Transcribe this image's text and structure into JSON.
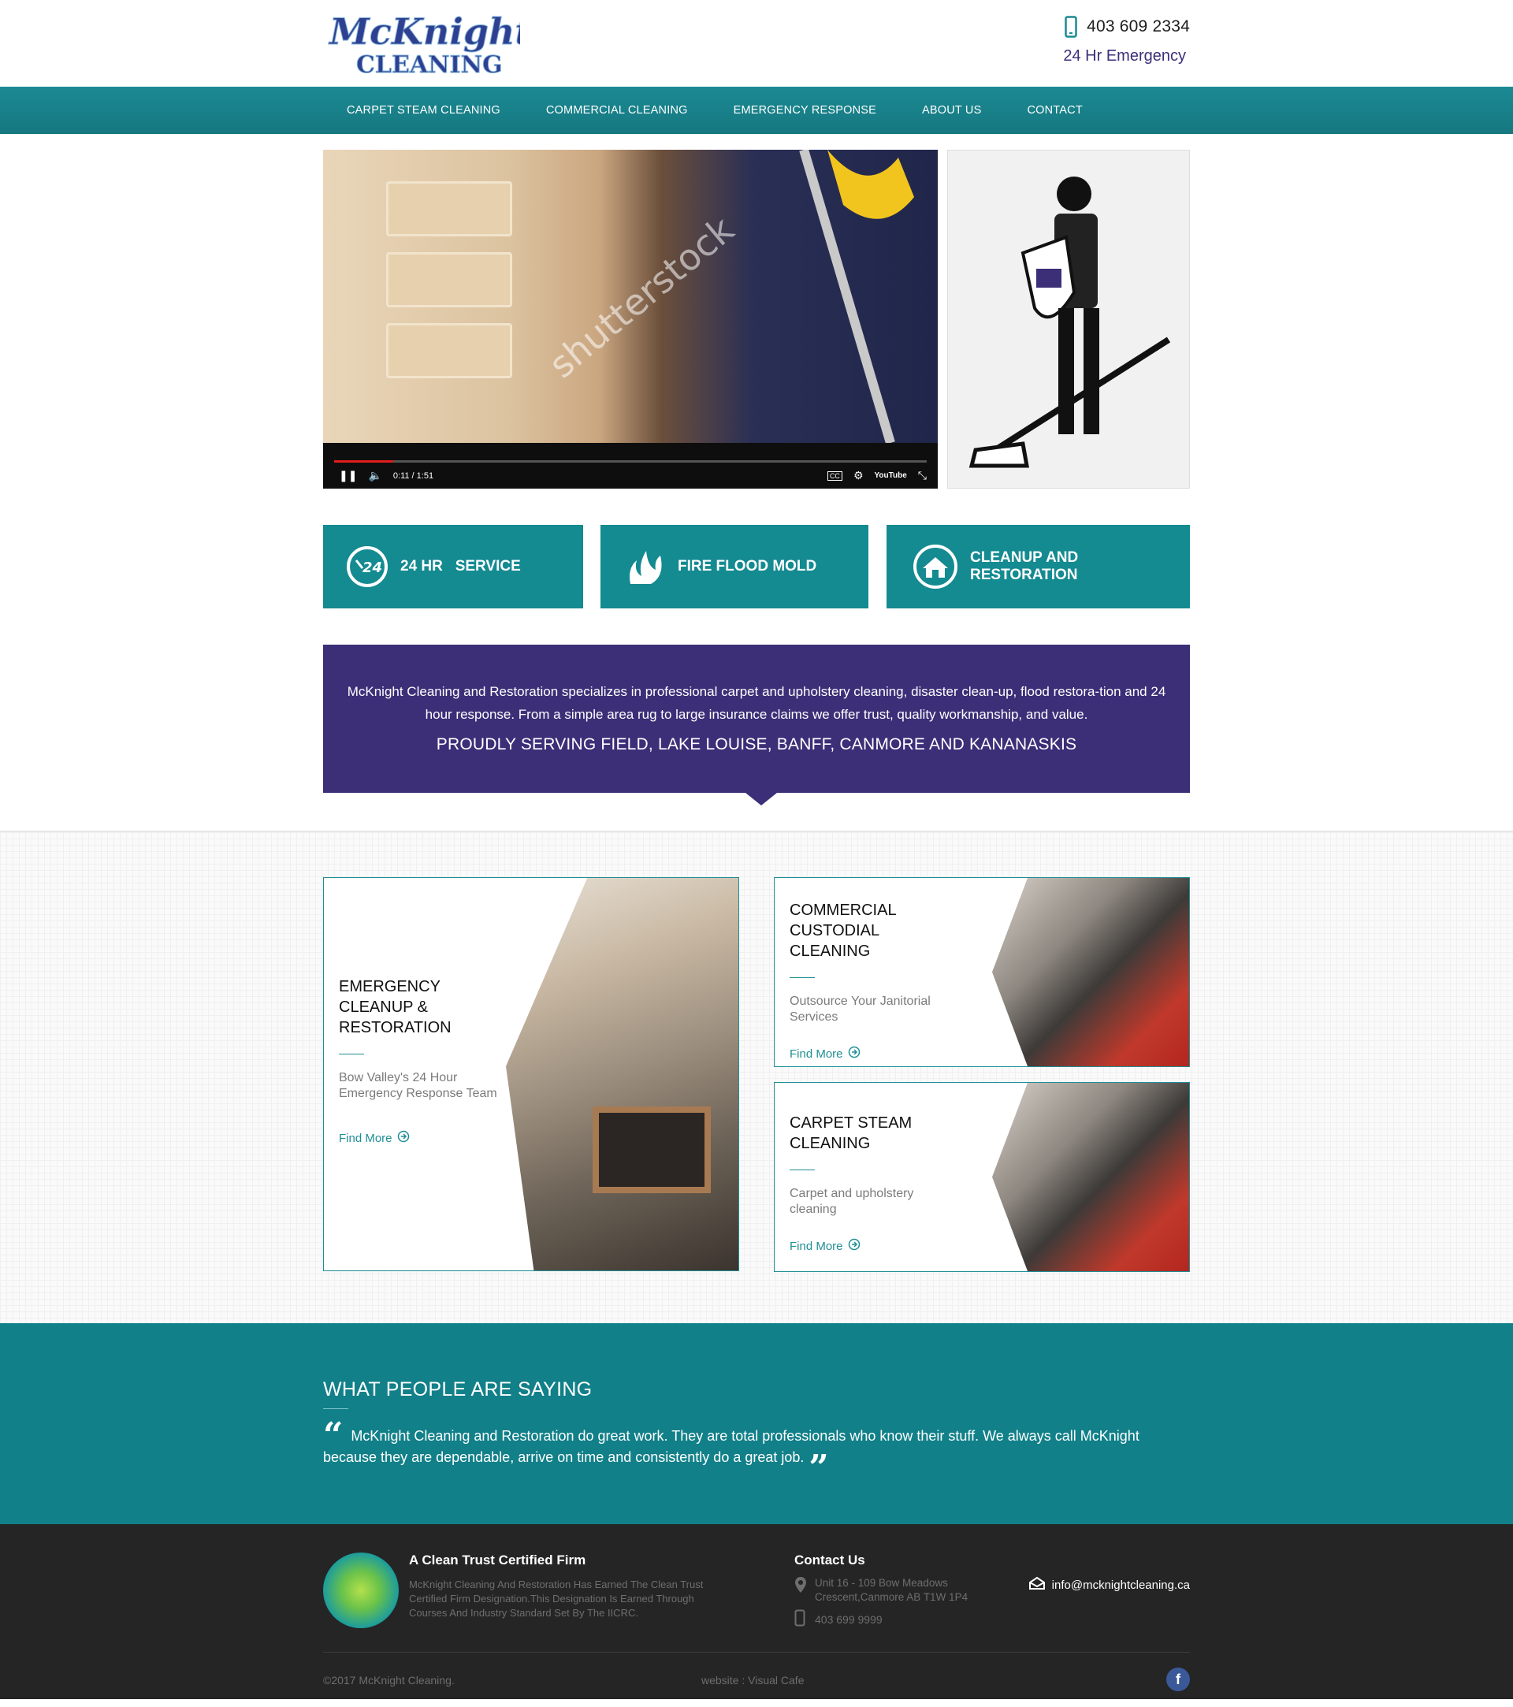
{
  "header": {
    "logo_line1": "McKnight",
    "logo_line2": "CLEANING",
    "phone": "403 609 2334",
    "emergency": "24 Hr Emergency"
  },
  "nav": {
    "items": [
      "CARPET STEAM CLEANING",
      "COMMERCIAL CLEANING",
      "EMERGENCY RESPONSE",
      "ABOUT US",
      "CONTACT"
    ]
  },
  "video": {
    "watermark": "shutterstock",
    "time": "0:11 / 1:51",
    "progress": 0.1,
    "cc_label": "CC",
    "youtube_label": "YouTube"
  },
  "features": [
    {
      "label": "24 HR   SERVICE",
      "icon": "clock-24-icon"
    },
    {
      "label": "FIRE FLOOD MOLD",
      "icon": "flame-water-icon"
    },
    {
      "label": "CLEANUP AND RESTORATION",
      "icon": "home-circle-icon"
    }
  ],
  "banner": {
    "text": "McKnight Cleaning and Restoration specializes in professional carpet and upholstery cleaning, disaster clean-up, flood restora-tion and 24 hour response.  From a simple area rug to large insurance claims we offer trust, quality workmanship, and value.",
    "headline": "PROUDLY SERVING FIELD, LAKE LOUISE, BANFF, CANMORE AND KANANASKIS"
  },
  "cards": [
    {
      "title": "EMERGENCY CLEANUP & RESTORATION",
      "desc": "Bow Valley's 24 Hour Emergency Response Team",
      "link": "Find More"
    },
    {
      "title": "COMMERCIAL CUSTODIAL CLEANING",
      "desc": "Outsource Your Janitorial Services",
      "link": "Find More"
    },
    {
      "title": "CARPET STEAM CLEANING",
      "desc": "Carpet and upholstery cleaning",
      "link": "Find More"
    }
  ],
  "testimonials": {
    "heading": "WHAT PEOPLE ARE SAYING",
    "quote": "McKnight Cleaning and Restoration do great work. They are total professionals who know their stuff. We always call McKnight because they are dependable, arrive on time and consistently do a great job."
  },
  "footer": {
    "cert_title": "A Clean Trust Certified Firm",
    "cert_desc": "McKnight Cleaning And Restoration Has Earned The Clean Trust Certified Firm Designation.This Designation Is Earned Through Courses And Industry Standard Set By The IICRC.",
    "contact_title": "Contact Us",
    "address_line1": "Unit 16 - 109 Bow Meadows",
    "address_line2": "Crescent,Canmore AB T1W 1P4",
    "phone": "403 699 9999",
    "email": "info@mcknightcleaning.ca",
    "copyright": "©2017 McKnight Cleaning.",
    "credit": "website : Visual Cafe",
    "facebook": "f"
  },
  "colors": {
    "teal": "#148a91",
    "purple": "#3c2f78",
    "footer_bg": "#252525"
  }
}
